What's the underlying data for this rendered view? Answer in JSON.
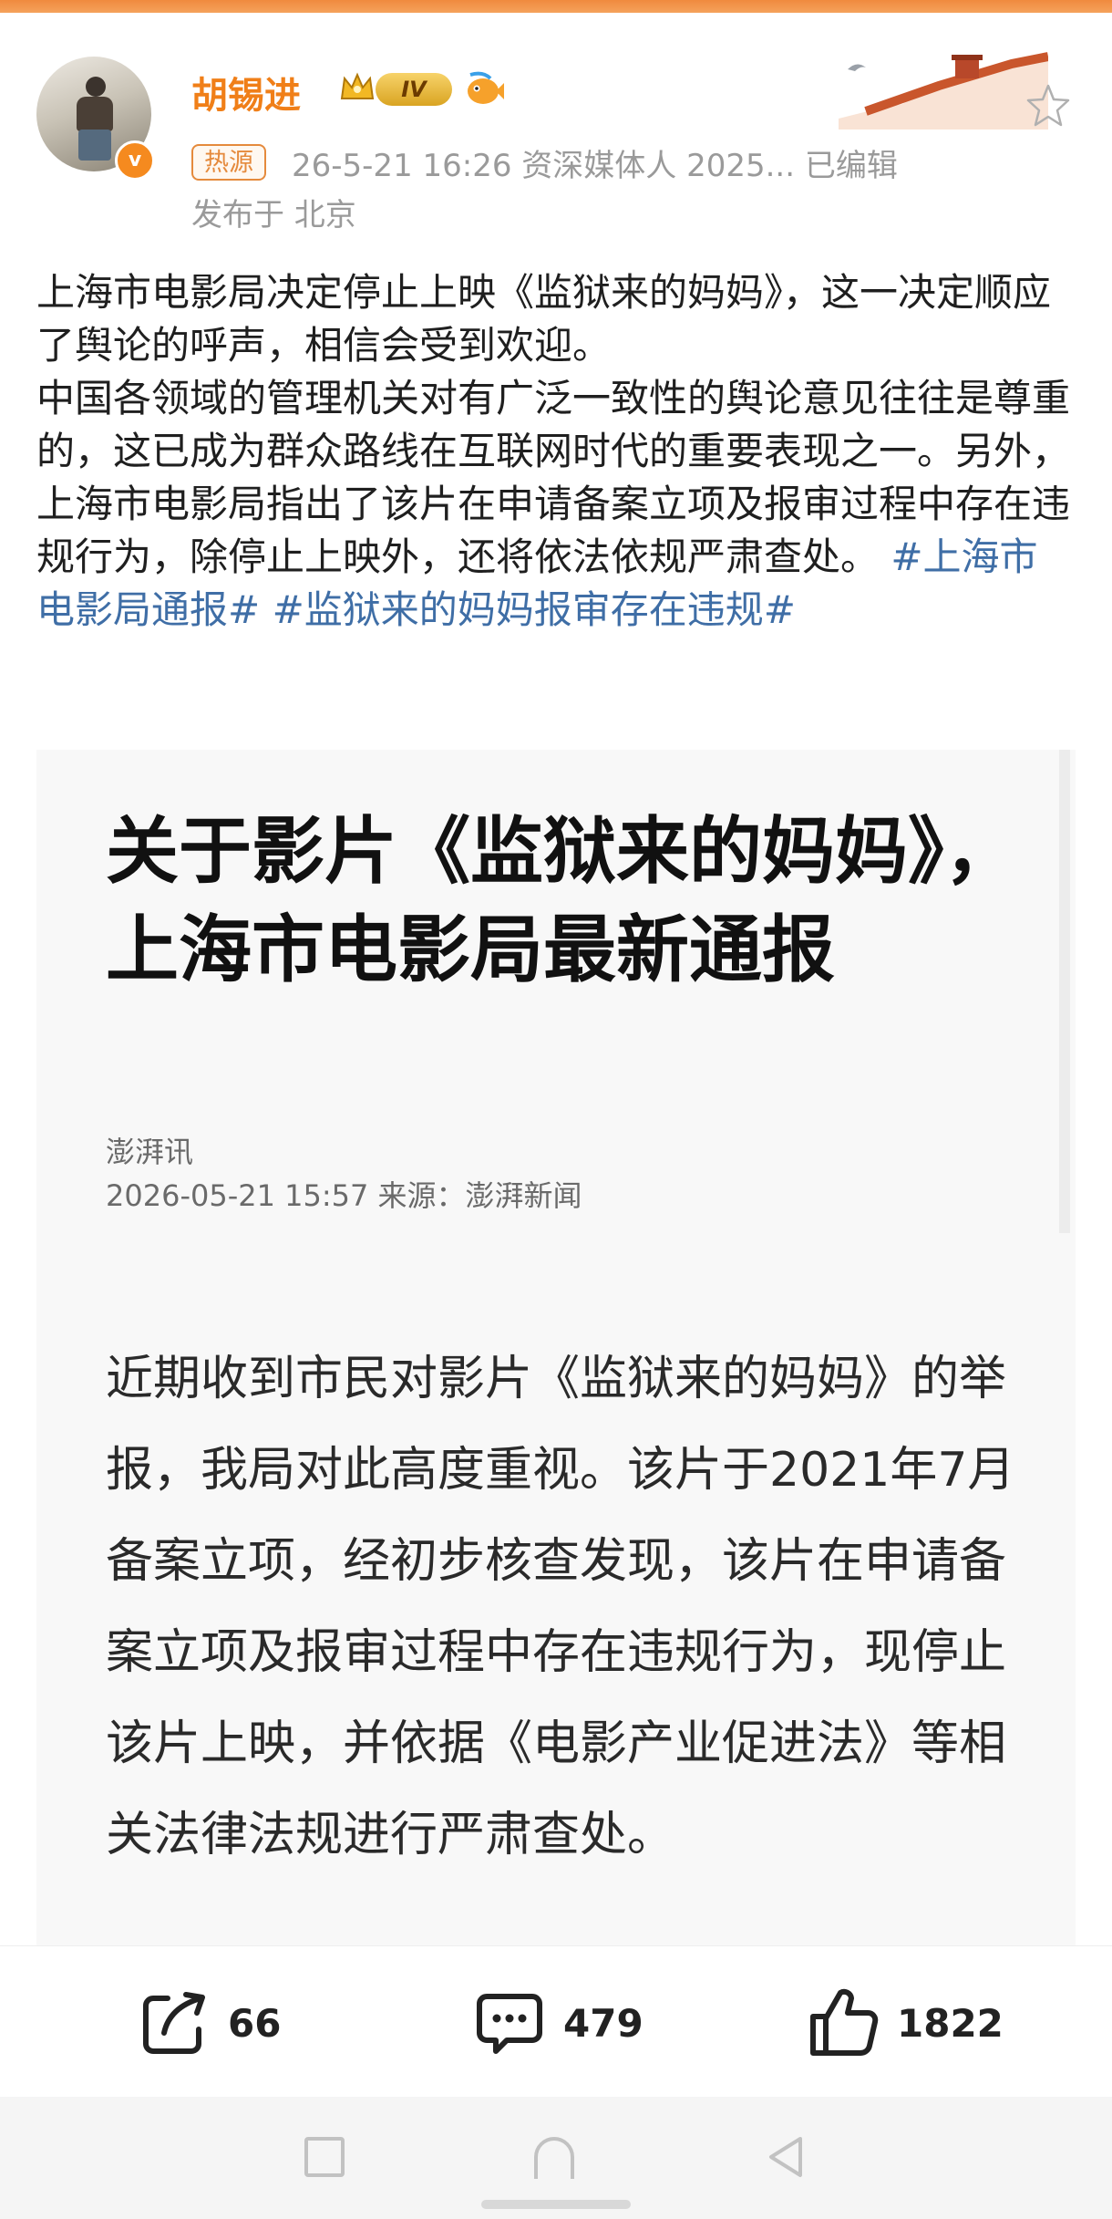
{
  "header": {
    "username": "胡锡进",
    "level_badge": "IV",
    "hot_tag": "热源",
    "meta": "26-5-21 16:26  资深媒体人 2025...  已编辑",
    "location": "发布于 北京",
    "verify_mark": "v"
  },
  "post": {
    "paragraph1": "上海市电影局决定停止上映《监狱来的妈妈》，这一决定顺应了舆论的呼声，相信会受到欢迎。",
    "paragraph2_text": "中国各领域的管理机关对有广泛一致性的舆论意见往往是尊重的，这已成为群众路线在互联网时代的重要表现之一。另外，上海市电影局指出了该片在申请备案立项及报审过程中存在违规行为，除停止上映外，还将依法依规严肃查处。 ",
    "hashtag1": "#上海市电影局通报#",
    "hashtag2": "#监狱来的妈妈报审存在违规#"
  },
  "embed": {
    "title": "关于影片《监狱来的妈妈》，上海市电影局最新通报",
    "source": "澎湃讯",
    "meta": "2026-05-21 15:57   来源：澎湃新闻",
    "body": "近期收到市民对影片《监狱来的妈妈》的举报，我局对此高度重视。该片于2021年7月备案立项，经初步核查发现，该片在申请备案立项及报审过程中存在违规行为，现停止该片上映，并依据《电影产业促进法》等相关法律法规进行严肃查处。"
  },
  "actions": {
    "share_count": "66",
    "comment_count": "479",
    "like_count": "1822"
  },
  "colors": {
    "accent_orange": "#f07f18",
    "hashtag_blue": "#3f6ea6",
    "meta_gray": "#9a9a9a"
  }
}
